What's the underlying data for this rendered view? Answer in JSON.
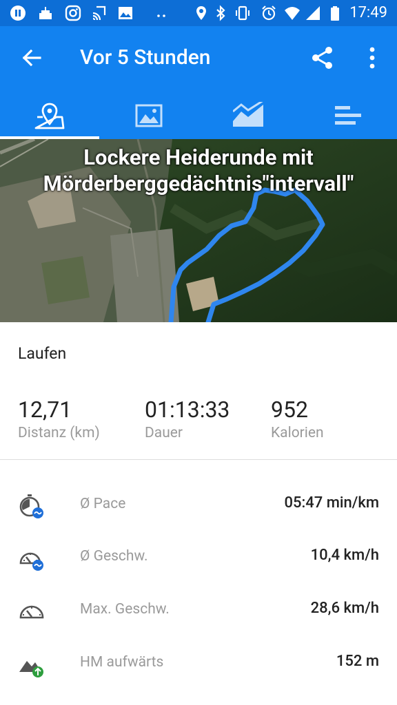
{
  "status_bar": {
    "time": "17:49",
    "icons": [
      "pause-circle-icon",
      "cake-icon",
      "instagram-icon",
      "cast-icon",
      "image-icon",
      "dots-icon",
      "location-icon",
      "bluetooth-icon",
      "vibrate-icon",
      "alarm-icon",
      "wifi-icon",
      "signal-icon",
      "battery-icon"
    ]
  },
  "app_bar": {
    "title": "Vor 5 Stunden",
    "back_icon": "arrow-left-icon",
    "share_icon": "share-icon",
    "more_icon": "more-vert-icon"
  },
  "tabs": [
    {
      "name": "map",
      "icon": "map-pin-icon",
      "selected": true
    },
    {
      "name": "photos",
      "icon": "image-icon",
      "selected": false
    },
    {
      "name": "charts",
      "icon": "area-chart-icon",
      "selected": false
    },
    {
      "name": "details",
      "icon": "bar-list-icon",
      "selected": false
    }
  ],
  "map": {
    "route_title": "Lockere Heiderunde mit Mörderberggedächtnis\"intervall\"",
    "route_color": "#2f86ee"
  },
  "activity": {
    "type": "Laufen"
  },
  "summary": [
    {
      "value": "12,71",
      "label": "Distanz (km)"
    },
    {
      "value": "01:13:33",
      "label": "Dauer"
    },
    {
      "value": "952",
      "label": "Kalorien"
    }
  ],
  "metrics": [
    {
      "icon": "pace-stopwatch-icon",
      "label": "Ø Pace",
      "value": "05:47 min/km"
    },
    {
      "icon": "speedometer-avg-icon",
      "label": "Ø Geschw.",
      "value": "10,4 km/h"
    },
    {
      "icon": "speedometer-icon",
      "label": "Max. Geschw.",
      "value": "28,6 km/h"
    },
    {
      "icon": "elevation-up-icon",
      "label": "HM aufwärts",
      "value": "152 m"
    }
  ],
  "colors": {
    "primary": "#1282f0",
    "primary_dark": "#0d6ed6",
    "metric_badge": "#1f6fd8",
    "elevation_badge": "#2e9e3e"
  }
}
